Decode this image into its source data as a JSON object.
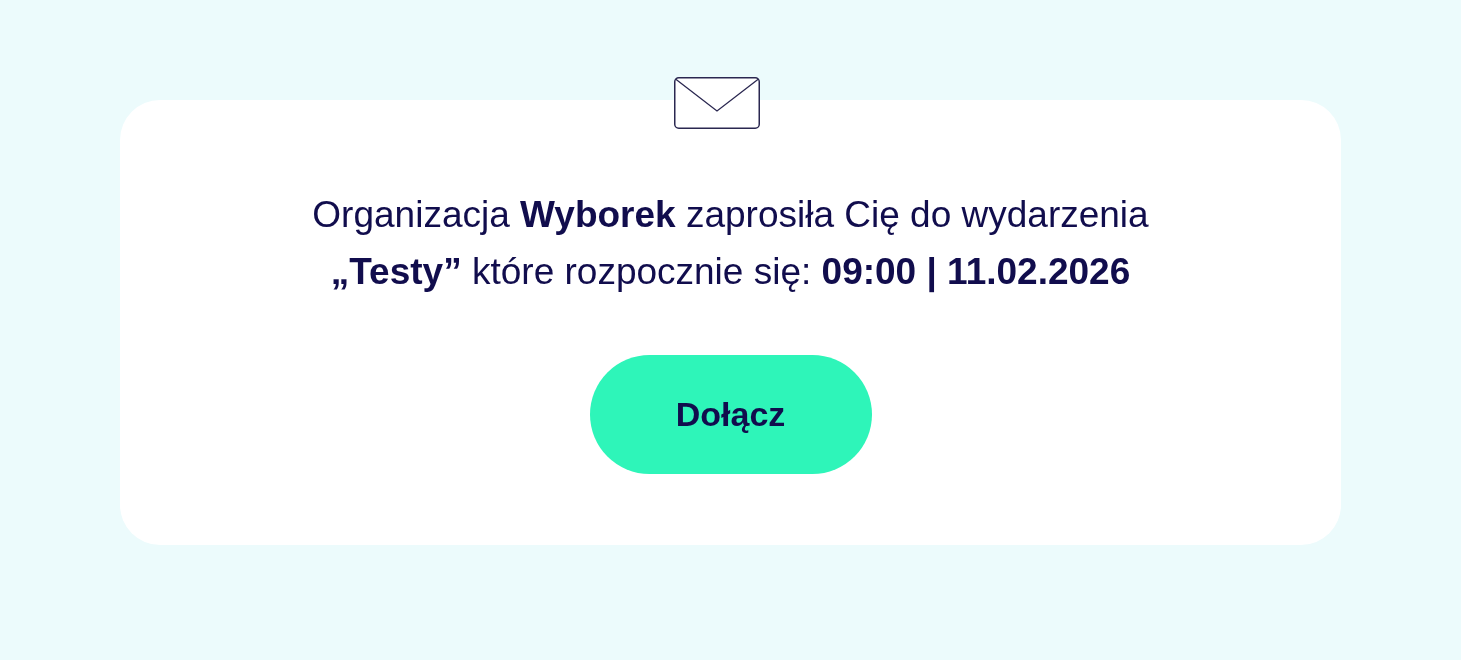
{
  "invitation": {
    "message": "Organizacja **Wyborek** zaprosiła Cię do wydarzenia **„Testy”** które rozpocznie się: **09:00 | 11.02.2026**"
  },
  "join_button": {
    "label": "Dołącz"
  }
}
